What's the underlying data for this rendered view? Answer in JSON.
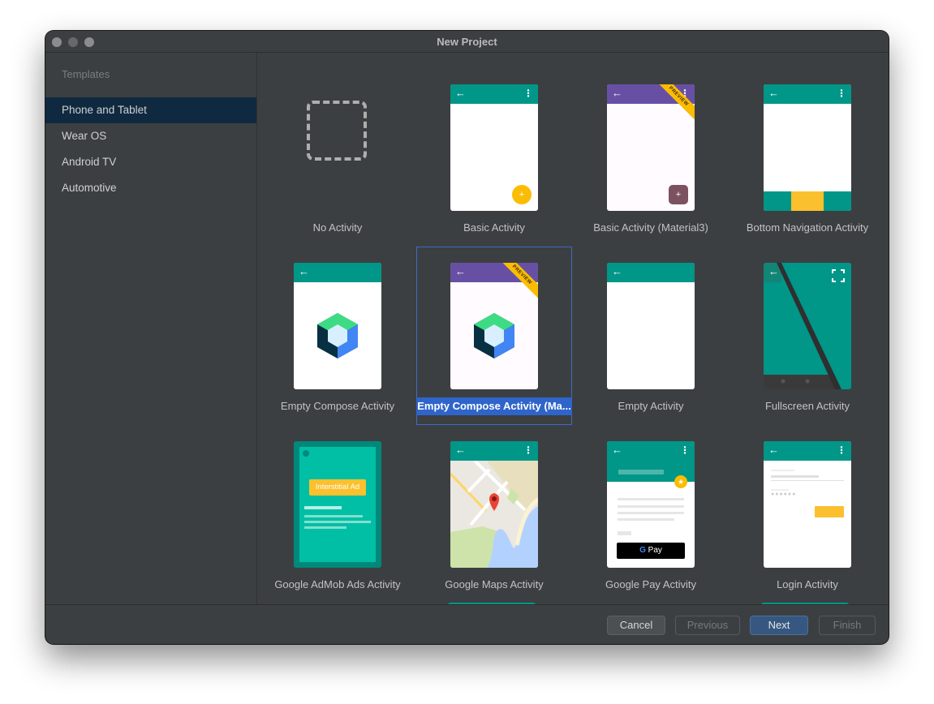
{
  "window": {
    "title": "New Project"
  },
  "sidebar": {
    "header": "Templates",
    "items": [
      {
        "label": "Phone and Tablet",
        "selected": true
      },
      {
        "label": "Wear OS",
        "selected": false
      },
      {
        "label": "Android TV",
        "selected": false
      },
      {
        "label": "Automotive",
        "selected": false
      }
    ]
  },
  "templates": [
    {
      "label": "No Activity",
      "icon": "no-activity-placeholder-icon"
    },
    {
      "label": "Basic Activity",
      "icon": "basic-activity-preview"
    },
    {
      "label": "Basic Activity (Material3)",
      "icon": "basic-activity-material3-preview",
      "badge": "PREVIEW"
    },
    {
      "label": "Bottom Navigation Activity",
      "icon": "bottom-navigation-preview"
    },
    {
      "label": "Empty Compose Activity",
      "icon": "compose-logo-icon"
    },
    {
      "label": "Empty Compose Activity (Ma...",
      "icon": "compose-logo-icon",
      "badge": "PREVIEW",
      "selected": true
    },
    {
      "label": "Empty Activity",
      "icon": "empty-activity-preview"
    },
    {
      "label": "Fullscreen Activity",
      "icon": "fullscreen-preview"
    },
    {
      "label": "Google AdMob Ads Activity",
      "icon": "admob-preview",
      "ad_text": "Interstitial Ad"
    },
    {
      "label": "Google Maps Activity",
      "icon": "maps-preview"
    },
    {
      "label": "Google Pay Activity",
      "icon": "gpay-preview",
      "pay_text": "Pay"
    },
    {
      "label": "Login Activity",
      "icon": "login-preview"
    }
  ],
  "footer": {
    "cancel": "Cancel",
    "previous": "Previous",
    "next": "Next",
    "finish": "Finish"
  },
  "colors": {
    "accent_selected": "#2f65ca",
    "teal": "#009688",
    "purple": "#6750a4",
    "amber": "#fbbc04"
  }
}
